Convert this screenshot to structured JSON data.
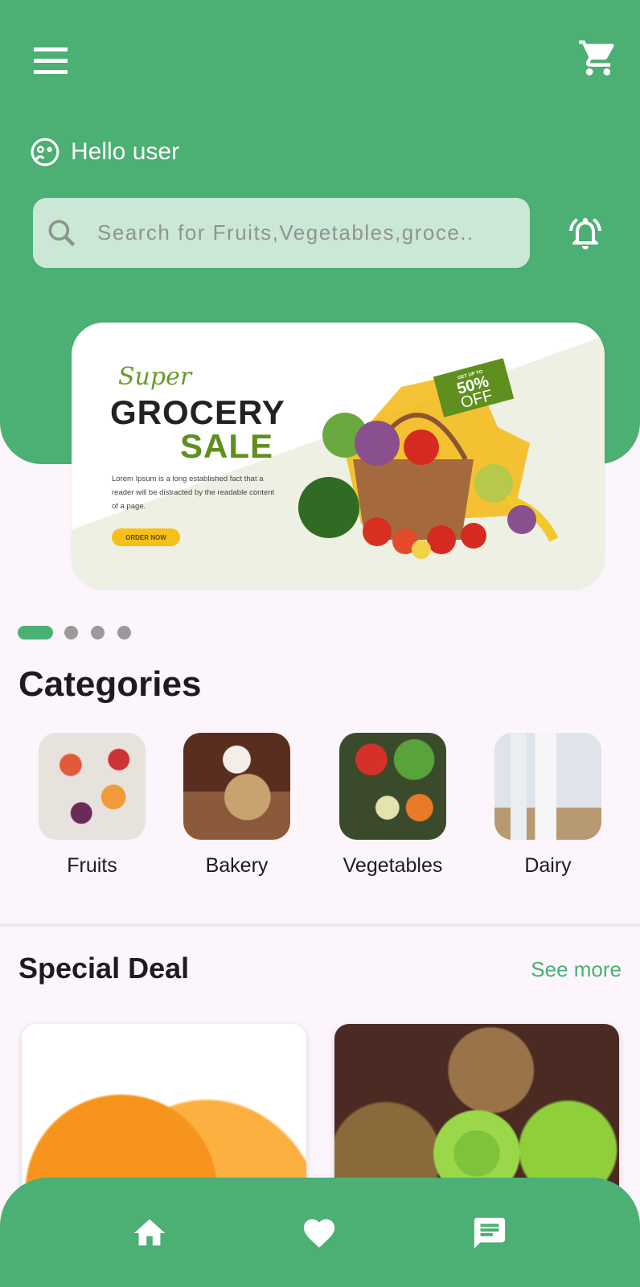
{
  "header": {
    "greeting": "Hello user",
    "search_placeholder": "Search for Fruits,Vegetables,groce.."
  },
  "banner": {
    "super": "Super",
    "grocery": "GROCERY",
    "sale": "SALE",
    "body": "Lorem Ipsum is a long established fact that a reader will be distracted by the readable content of a page.",
    "order_button": "ORDER NOW",
    "badge_top": "GET UP TO",
    "badge_pct": "50%",
    "badge_off": "OFF"
  },
  "carousel": {
    "count": 4,
    "active": 0
  },
  "categories": {
    "title": "Categories",
    "items": [
      {
        "label": "Fruits"
      },
      {
        "label": "Bakery"
      },
      {
        "label": "Vegetables"
      },
      {
        "label": "Dairy"
      }
    ]
  },
  "special_deal": {
    "title": "Special Deal",
    "see_more": "See more",
    "items": [
      "orange",
      "kiwi"
    ]
  },
  "colors": {
    "primary": "#4caf73",
    "background": "#fcf5fc",
    "search_bg": "#cbe8d7"
  },
  "nav": {
    "items": [
      "home-icon",
      "heart-icon",
      "chat-icon"
    ]
  }
}
